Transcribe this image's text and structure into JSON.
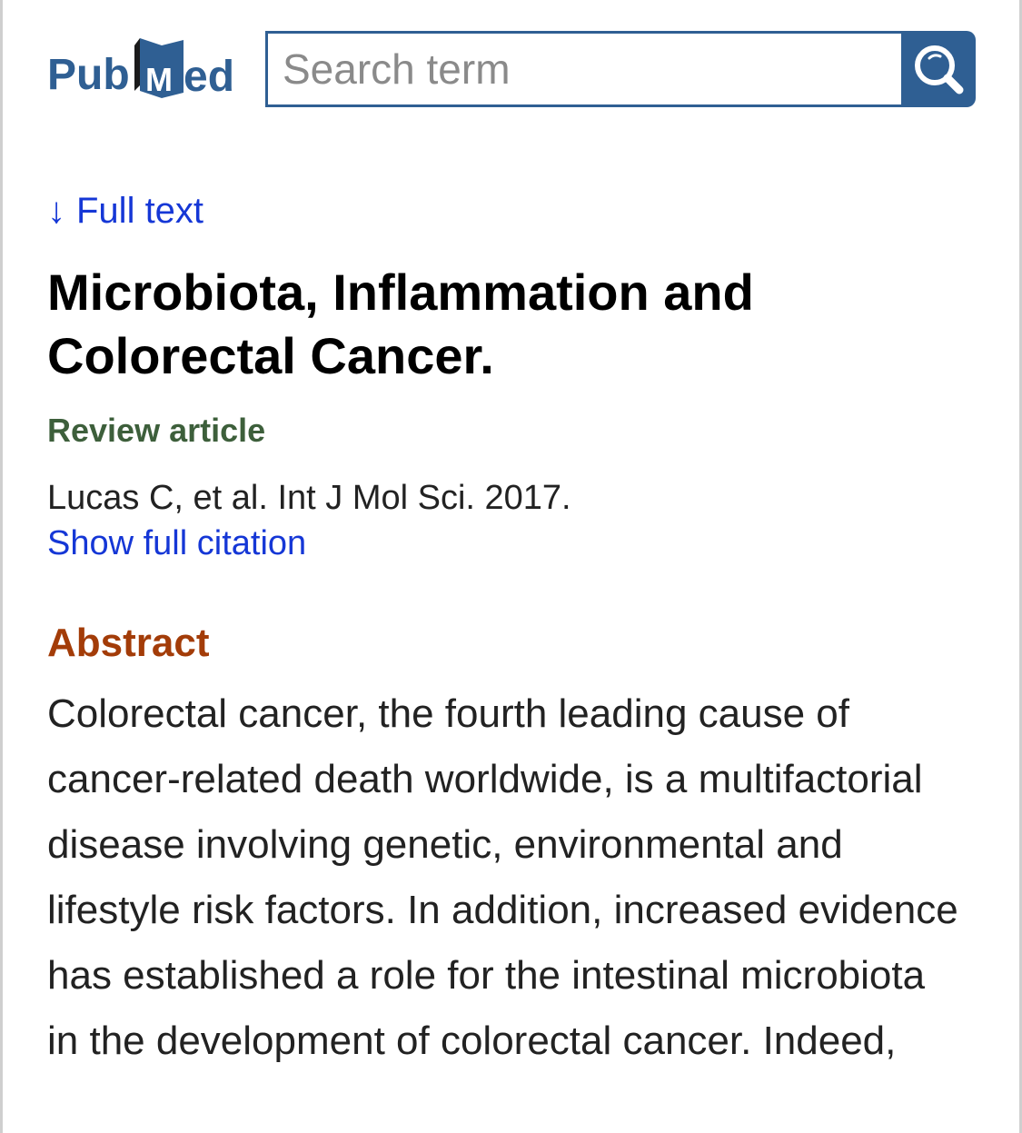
{
  "header": {
    "logo_text": "PubMed",
    "search": {
      "placeholder": "Search term",
      "value": ""
    }
  },
  "article": {
    "full_text_link": "Full text",
    "full_text_arrow": "↓",
    "title": "Microbiota, Inflammation and Colorectal Cancer.",
    "article_type": "Review article",
    "citation": "Lucas C, et al. Int J Mol Sci. 2017.",
    "show_citation_link": "Show full citation",
    "abstract_heading": "Abstract",
    "abstract_text": "Colorectal cancer, the fourth leading cause of cancer-related death worldwide, is a multifactorial disease involving genetic, environmental and lifestyle risk factors. In addition, increased evidence has established a role for the intestinal microbiota in the development of colorectal cancer. Indeed,"
  },
  "colors": {
    "brand_blue": "#2f5f93",
    "link_blue": "#1537d6",
    "article_type_green": "#3d5f3b",
    "abstract_orange": "#a33c08"
  },
  "icons": {
    "search": "magnifier-icon",
    "logo": "pubmed-logo"
  }
}
